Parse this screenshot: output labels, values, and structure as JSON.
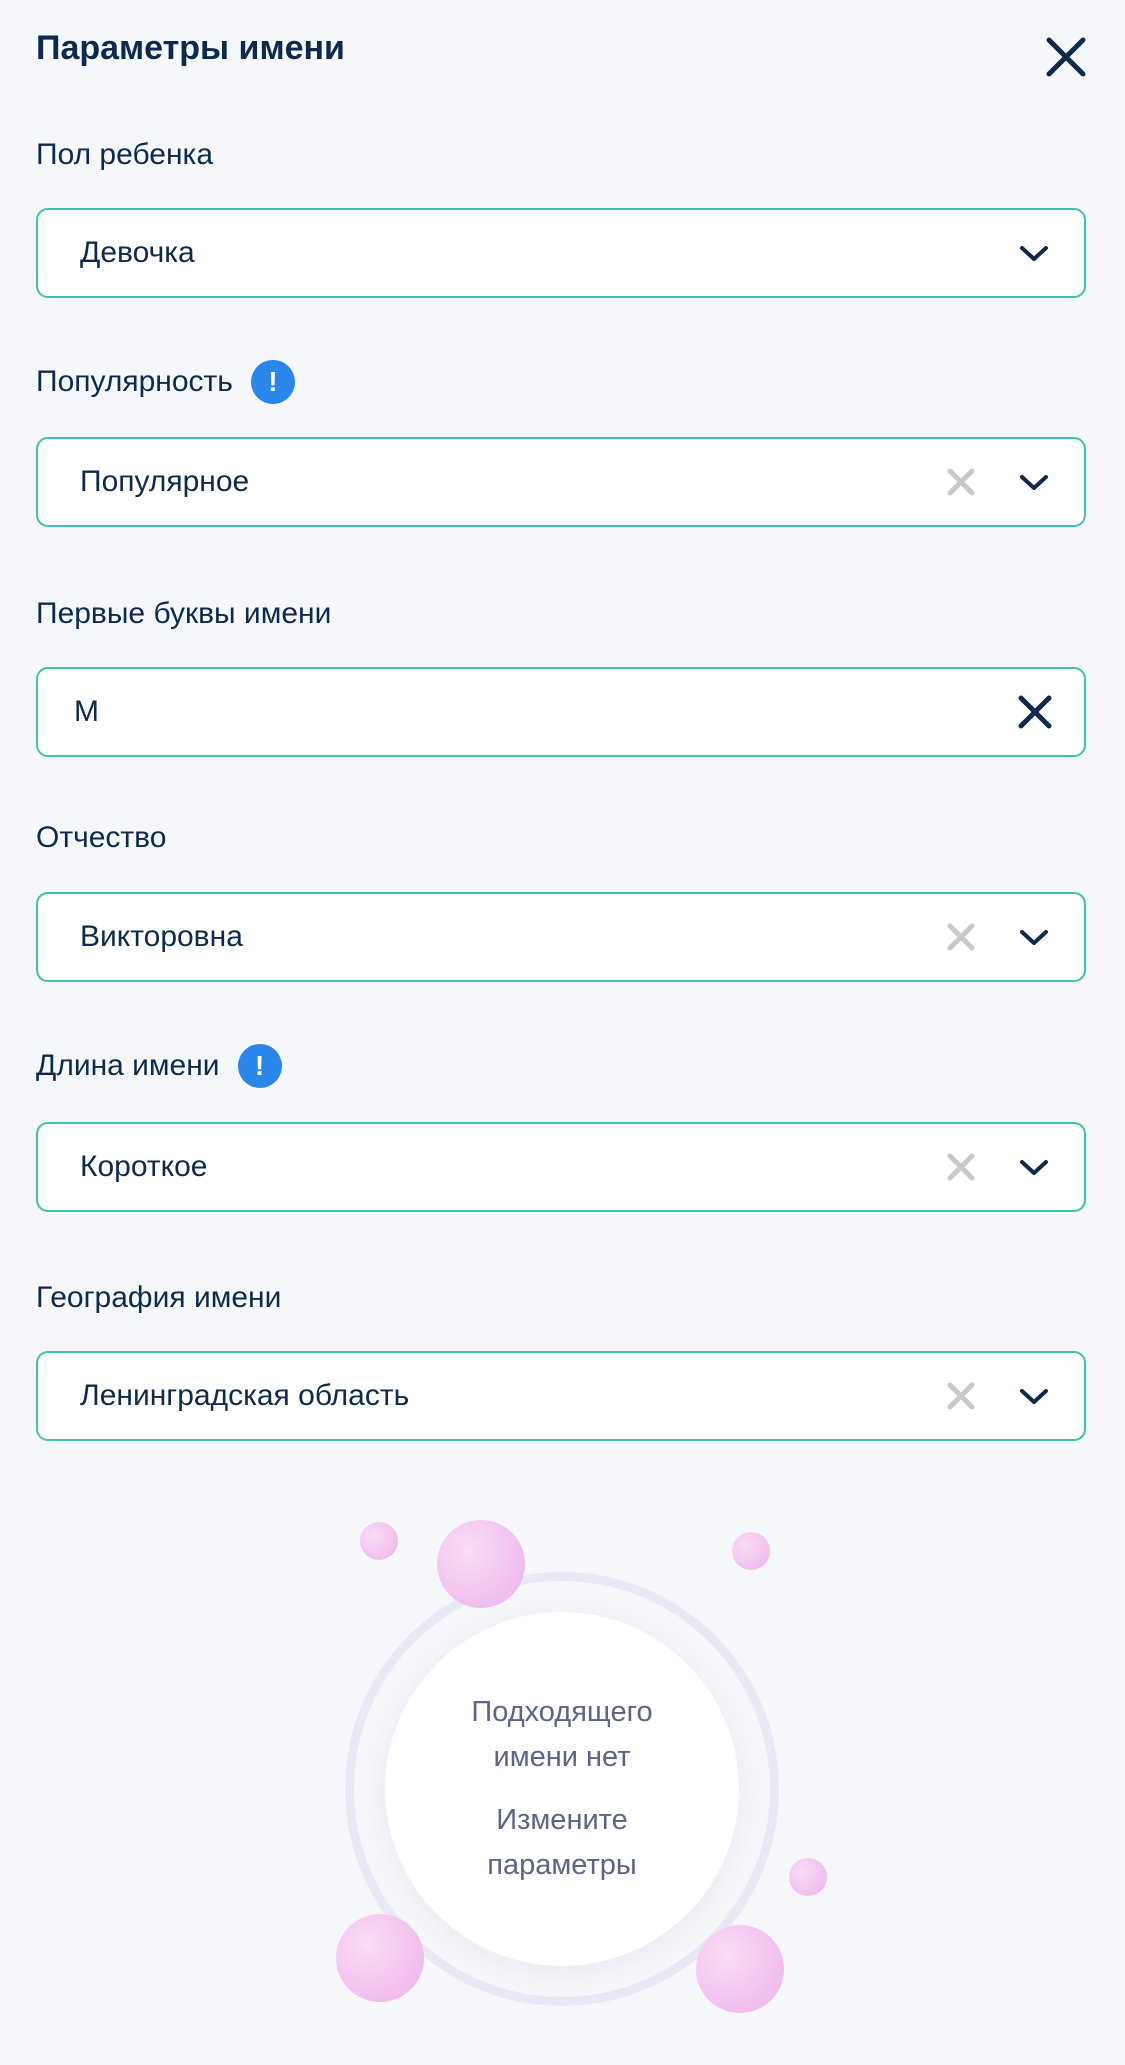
{
  "header": {
    "title": "Параметры имени",
    "close_icon": "close-icon"
  },
  "fields": {
    "gender": {
      "label": "Пол ребенка",
      "value": "Девочка"
    },
    "popularity": {
      "label": "Популярность",
      "value": "Популярное",
      "info": "!"
    },
    "first_letters": {
      "label": "Первые буквы имени",
      "value": "М"
    },
    "patronymic": {
      "label": "Отчество",
      "value": "Викторовна"
    },
    "length": {
      "label": "Длина имени",
      "value": "Короткое",
      "info": "!"
    },
    "geography": {
      "label": "География имени",
      "value": "Ленинградская область"
    }
  },
  "empty_state": {
    "line1": "Подходящего",
    "line2": "имени нет",
    "line3": "Измените",
    "line4": "параметры"
  },
  "colors": {
    "accent_border": "#3dc2b0",
    "info_blue": "#2a86e8",
    "text_dark": "#0d2a4e",
    "bubble_pink": "#efb0ea"
  }
}
